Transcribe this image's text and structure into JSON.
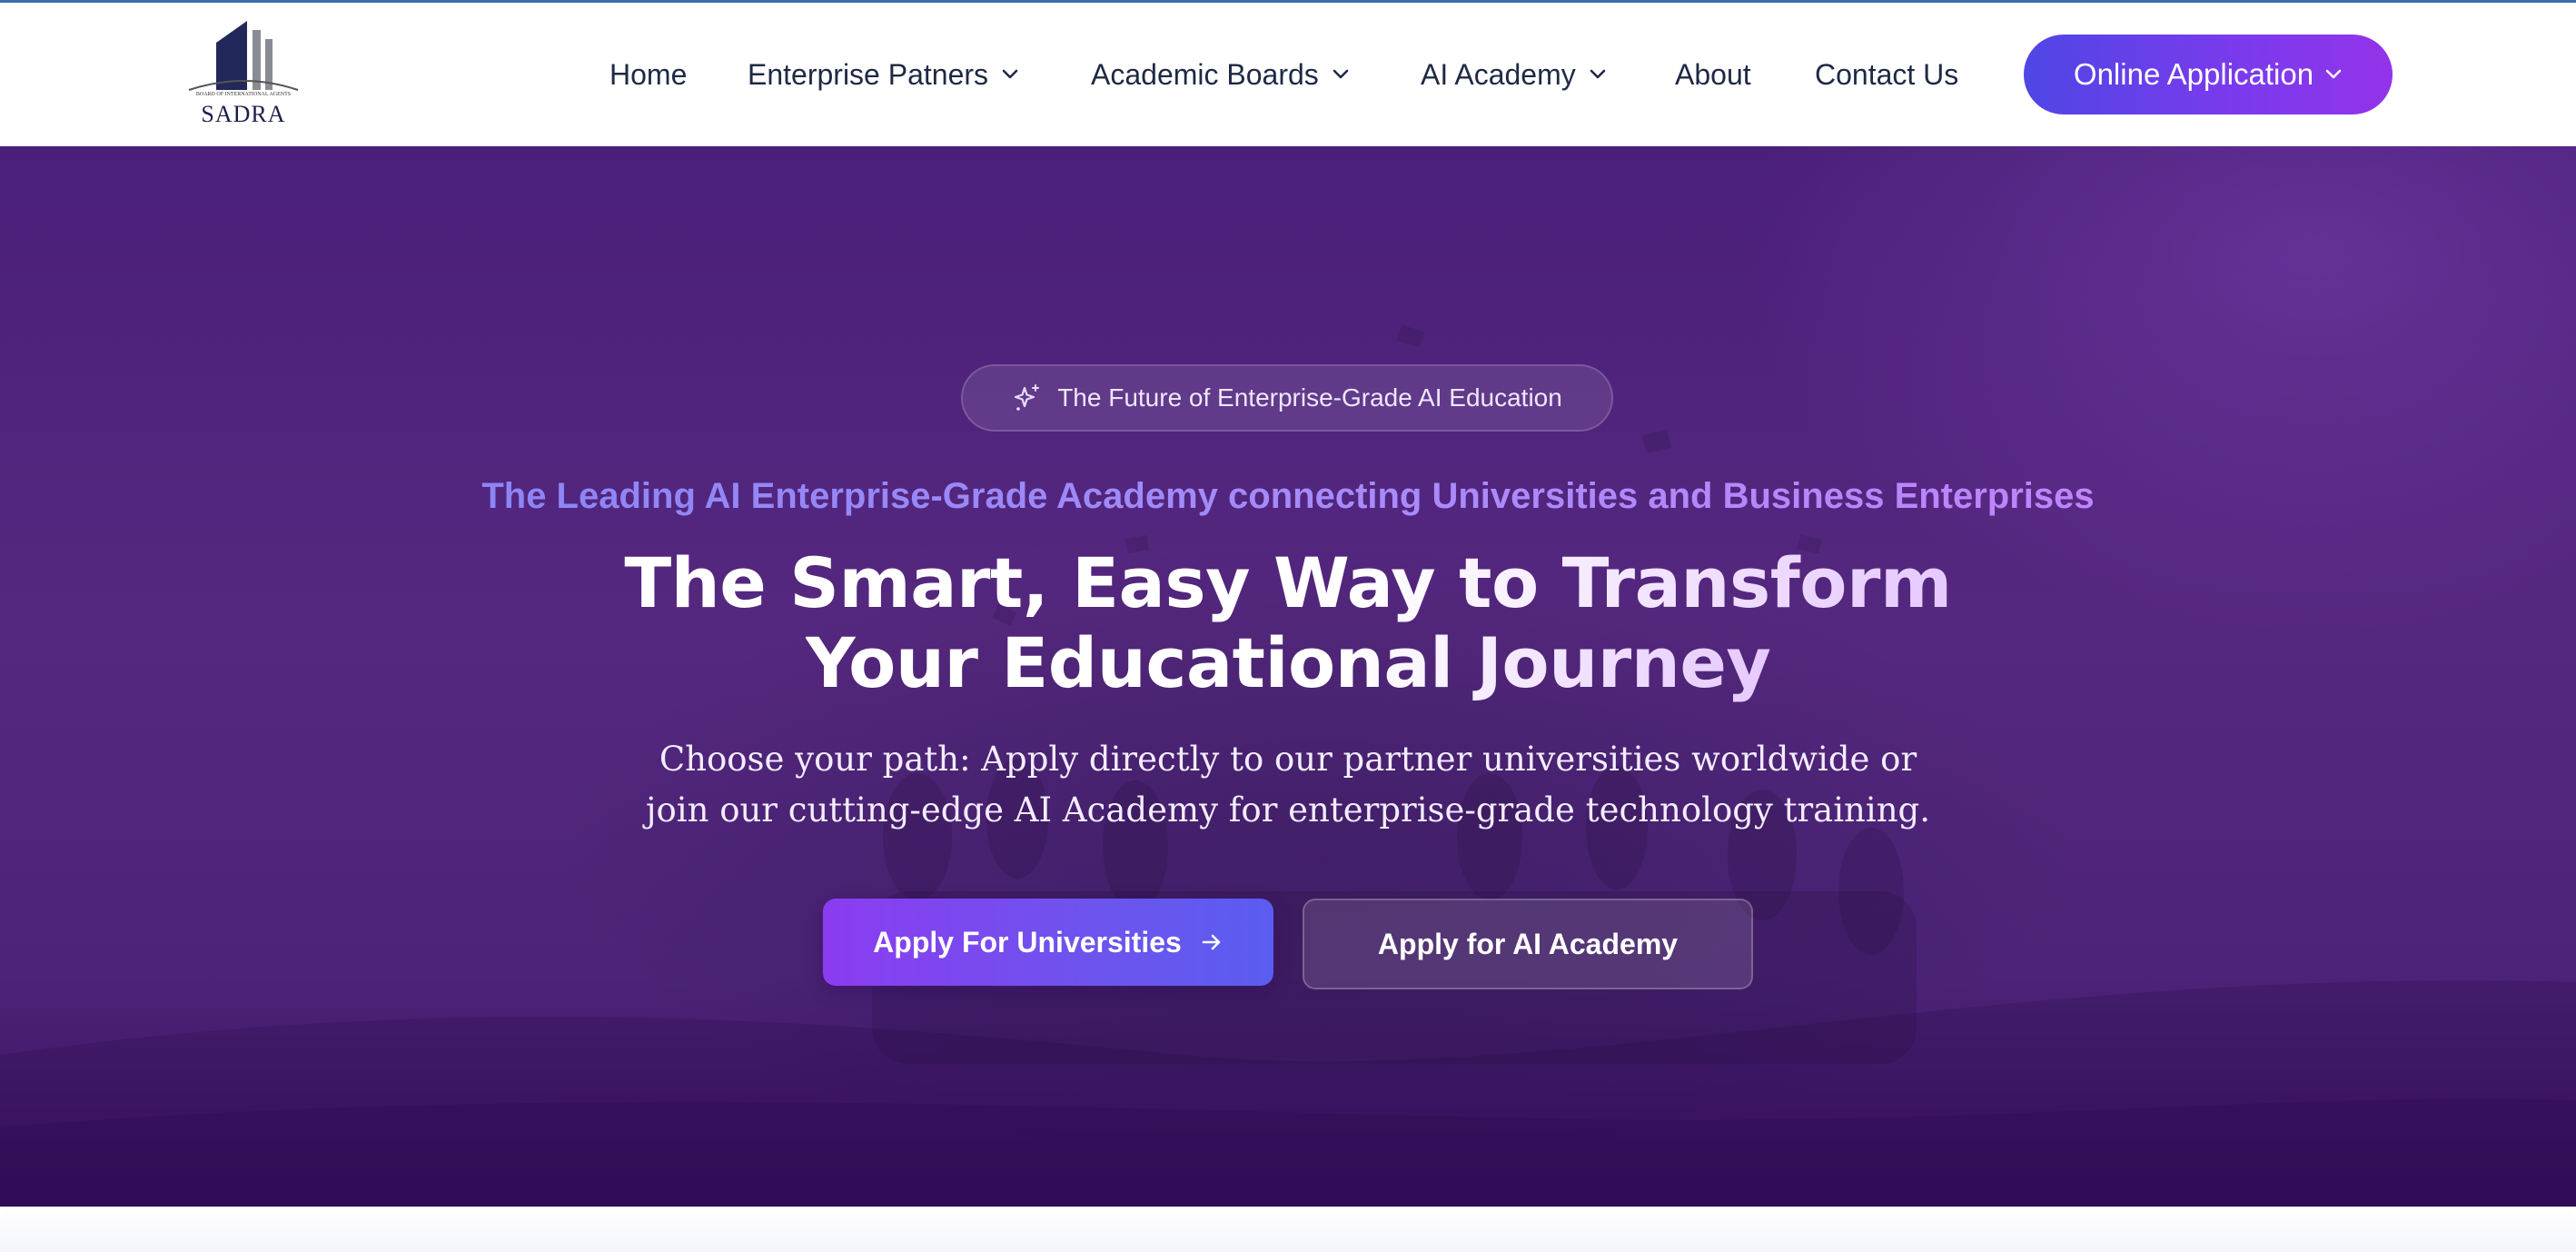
{
  "colors": {
    "nav_text": "#1e2a44",
    "cta_gradient_start": "#4f46e5",
    "cta_gradient_end": "#9333ea",
    "hero_bg": "#4a1f79",
    "tagline_color": "#8b85f5",
    "primary_button": "#8b3cf0"
  },
  "logo": {
    "tagline": "BOARD OF INTERNATIONAL AGENTS",
    "name": "SADRA"
  },
  "nav": {
    "items": [
      {
        "label": "Home",
        "icon": null
      },
      {
        "label": "Enterprise Patners",
        "icon": "chevron-down-icon"
      },
      {
        "label": "Academic Boards",
        "icon": "chevron-down-icon"
      },
      {
        "label": "AI Academy",
        "icon": "chevron-down-icon"
      },
      {
        "label": "About",
        "icon": null
      },
      {
        "label": "Contact Us",
        "icon": null
      }
    ],
    "cta": {
      "label": "Online Application",
      "icon": "chevron-down-icon"
    }
  },
  "hero": {
    "badge": {
      "label": "The Future of Enterprise-Grade AI Education",
      "icon": "sparkle-icon"
    },
    "tagline": "The Leading AI Enterprise-Grade Academy connecting Universities and Business Enterprises",
    "headline_lines": [
      "The Smart, Easy Way to Transform",
      "Your Educational Journey"
    ],
    "subtext_lines": [
      "Choose your path: Apply directly to our partner universities worldwide or",
      "join our cutting-edge AI Academy for enterprise-grade technology training."
    ],
    "primary_button": {
      "label": "Apply For Universities",
      "icon": "arrow-right-icon"
    },
    "secondary_button": {
      "label": "Apply for AI Academy"
    }
  }
}
